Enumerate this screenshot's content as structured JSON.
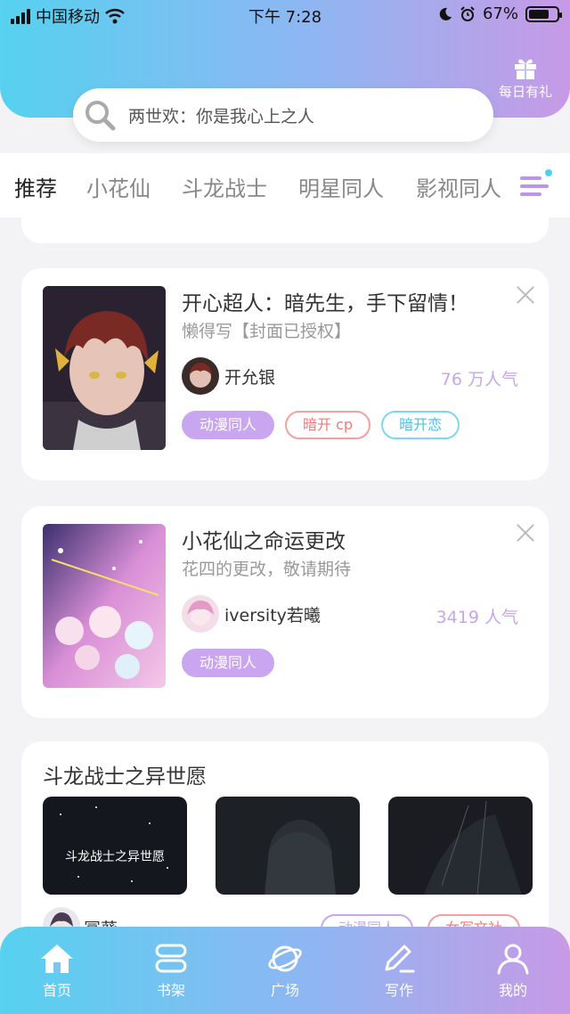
{
  "status_bar": {
    "carrier": "中国移动",
    "time": "下午 7:28",
    "battery": "67%"
  },
  "header": {
    "gift_label": "每日有礼",
    "search_placeholder": "两世欢：你是我心上之人"
  },
  "tabs": [
    {
      "label": "推荐",
      "active": true
    },
    {
      "label": "小花仙"
    },
    {
      "label": "斗龙战士"
    },
    {
      "label": "明星同人"
    },
    {
      "label": "影视同人"
    }
  ],
  "cards": [
    {
      "title": "开心超人：暗先生，手下留情！",
      "subtitle": "懒得写【封面已授权",
      "subtitle_end": "】",
      "author": "开允银",
      "popularity": "76 万人气",
      "tags": [
        "动漫同人",
        "暗开 cp",
        "暗开恋"
      ]
    },
    {
      "title": "小花仙之命运更改",
      "subtitle": "花四的更改，敬请期待",
      "author": "iversity若曦",
      "popularity": "3419 人气",
      "tags": [
        "动漫同人"
      ]
    }
  ],
  "collection": {
    "title": "斗龙战士之异世愿",
    "thumb_caption": "斗龙战士之异世愿",
    "author_peek": "冨葵",
    "tags": [
      "动漫同人",
      "女写文社"
    ]
  },
  "bottom_nav": [
    {
      "label": "首页",
      "icon": "home-icon",
      "active": true
    },
    {
      "label": "书架",
      "icon": "bookshelf-icon"
    },
    {
      "label": "广场",
      "icon": "planet-icon"
    },
    {
      "label": "写作",
      "icon": "pen-icon"
    },
    {
      "label": "我的",
      "icon": "profile-icon"
    }
  ],
  "colors": {
    "accent_purple": "#c9a6ef",
    "accent_blue": "#56d1f0",
    "tag_red": "#f07a7a"
  }
}
